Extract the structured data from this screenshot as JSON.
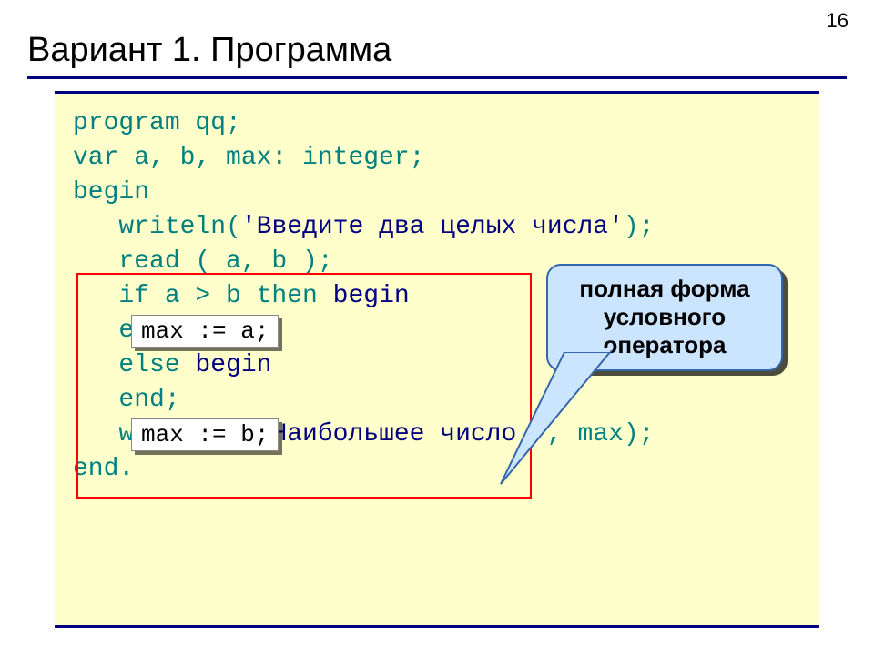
{
  "page_number": "16",
  "title": "Вариант 1. Программа",
  "code": {
    "l0": "program qq;",
    "l1": "var a, b, max: integer;",
    "l2": "begin",
    "l3a": "   writeln(",
    "l3b": "'Введите два целых числа'",
    "l3c": ");",
    "l4": "   read ( a, b );",
    "l5a": "   if a > b then ",
    "l5b": "begin",
    "l6_vis": "",
    "l7": "   end",
    "l8a": "   else ",
    "l8b": "begin",
    "l9_vis": "",
    "l10": "   end;",
    "l11a": "   writeln (",
    "l11b": "'Наибольшее число '",
    "l11c": ", max);",
    "l12": "end."
  },
  "assign1": "max := a;",
  "assign2": "max := b;",
  "callout": {
    "line1": "полная форма",
    "line2": "условного",
    "line3": "оператора"
  }
}
